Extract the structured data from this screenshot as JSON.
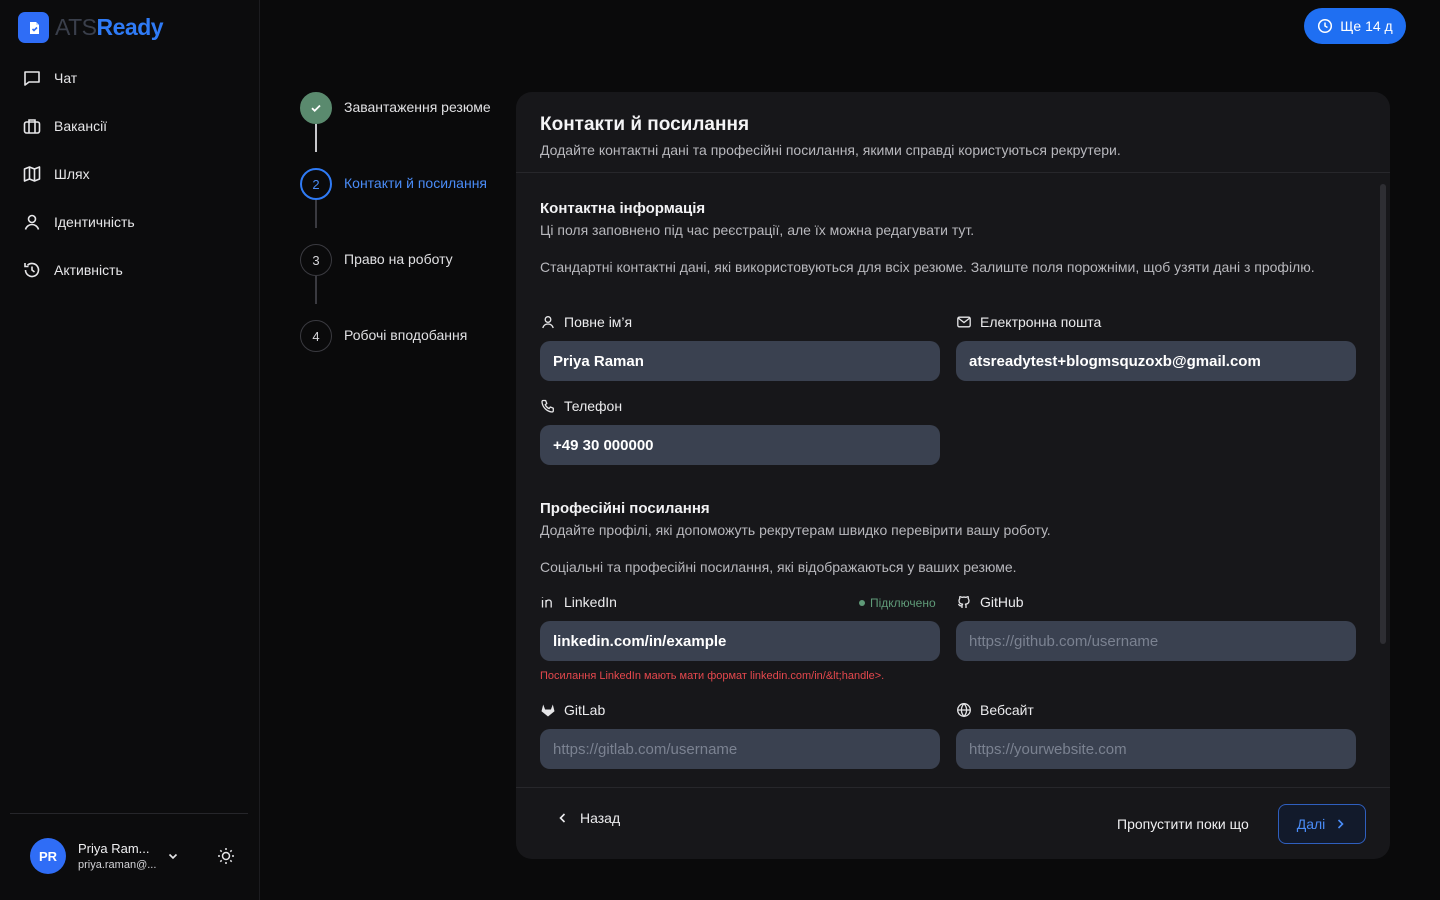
{
  "brand": {
    "name_prefix": "ATS",
    "name_suffix": "Ready"
  },
  "sidebar": {
    "items": [
      {
        "label": "Чат",
        "icon": "chat-icon"
      },
      {
        "label": "Вакансії",
        "icon": "briefcase-icon"
      },
      {
        "label": "Шлях",
        "icon": "map-icon"
      },
      {
        "label": "Ідентичність",
        "icon": "user-icon"
      },
      {
        "label": "Активність",
        "icon": "history-icon"
      }
    ],
    "user": {
      "initials": "PR",
      "name": "Priya Ram...",
      "email": "priya.raman@..."
    }
  },
  "trial": {
    "label": "Ще 14 д"
  },
  "stepper": {
    "steps": [
      {
        "number": "1",
        "label": "Завантаження резюме",
        "state": "done"
      },
      {
        "number": "2",
        "label": "Контакти й посилання",
        "state": "active"
      },
      {
        "number": "3",
        "label": "Право на роботу",
        "state": "pending"
      },
      {
        "number": "4",
        "label": "Робочі вподобання",
        "state": "pending"
      }
    ]
  },
  "card": {
    "title": "Контакти й посилання",
    "subtitle": "Додайте контактні дані та професійні посилання, якими справді користуються рекрутери.",
    "contact": {
      "title": "Контактна інформація",
      "subtitle": "Ці поля заповнено під час реєстрації, але їх можна редагувати тут.",
      "note": "Стандартні контактні дані, які використовуються для всіх резюме. Залиште поля порожніми, щоб узяти дані з профілю.",
      "name_label": "Повне ім’я",
      "name_value": "Priya Raman",
      "email_label": "Електронна пошта",
      "email_value": "atsreadytest+blogmsquzoxb@gmail.com",
      "phone_label": "Телефон",
      "phone_value": "+49 30 000000"
    },
    "links": {
      "title": "Професійні посилання",
      "subtitle": "Додайте профілі, які допоможуть рекрутерам швидко перевірити вашу роботу.",
      "note": "Соціальні та професійні посилання, які відображаються у ваших резюме.",
      "linkedin_label": "LinkedIn",
      "linkedin_status": "Підключено",
      "linkedin_value": "linkedin.com/in/example",
      "linkedin_error": "Посилання LinkedIn мають мати формат linkedin.com/in/&lt;handle>.",
      "github_label": "GitHub",
      "github_placeholder": "https://github.com/username",
      "gitlab_label": "GitLab",
      "gitlab_placeholder": "https://gitlab.com/username",
      "website_label": "Вебсайт",
      "website_placeholder": "https://yourwebsite.com"
    },
    "footer": {
      "back": "Назад",
      "skip": "Пропустити поки що",
      "next": "Далі"
    }
  },
  "colors": {
    "accent": "#2f6df6",
    "done_step": "#5a8a6e",
    "error": "#e5484d",
    "connected": "#5f9a78"
  }
}
